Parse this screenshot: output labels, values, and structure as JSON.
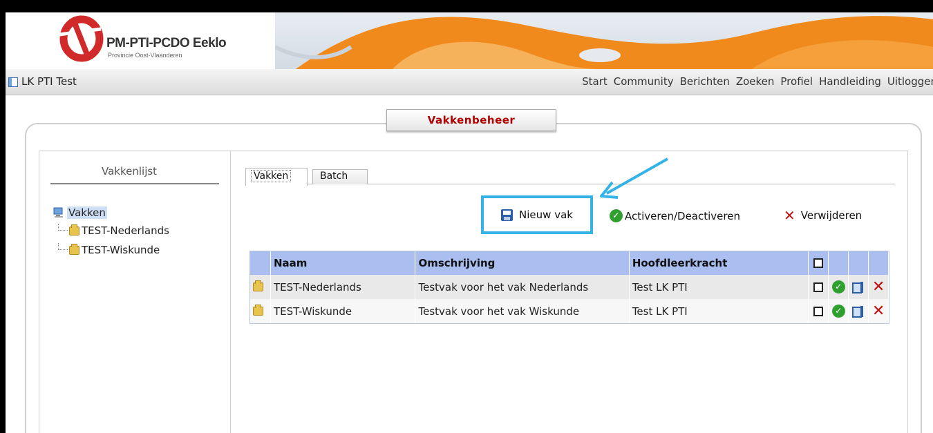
{
  "header": {
    "logo_title": "PM-PTI-PCDO Eeklo",
    "logo_subtitle": "Provincie Oost-Vlaanderen"
  },
  "navbar": {
    "app_title": "LK PTI Test",
    "links": [
      "Start",
      "Community",
      "Berichten",
      "Zoeken",
      "Profiel",
      "Handleiding",
      "Uitloggen"
    ]
  },
  "panel": {
    "title": "Vakkenbeheer"
  },
  "tree": {
    "title": "Vakkenlijst",
    "root": "Vakken",
    "children": [
      "TEST-Nederlands",
      "TEST-Wiskunde"
    ]
  },
  "tabs": [
    "Vakken",
    "Batch"
  ],
  "toolbar": {
    "new_label": "Nieuw vak",
    "activate_label": "Activeren/Deactiveren",
    "delete_label": "Verwijderen"
  },
  "table": {
    "headers": [
      "Naam",
      "Omschrijving",
      "Hoofdleerkracht"
    ],
    "rows": [
      {
        "naam": "TEST-Nederlands",
        "omschrijving": "Testvak voor het vak Nederlands",
        "hoofdleerkracht": "Test LK PTI"
      },
      {
        "naam": "TEST-Wiskunde",
        "omschrijving": "Testvak voor het vak Wiskunde",
        "hoofdleerkracht": "Test LK PTI"
      }
    ]
  },
  "colors": {
    "accent_orange": "#f08a1c",
    "panel_title": "#b00000",
    "highlight_box": "#36b3e6",
    "table_header": "#aabff0"
  }
}
